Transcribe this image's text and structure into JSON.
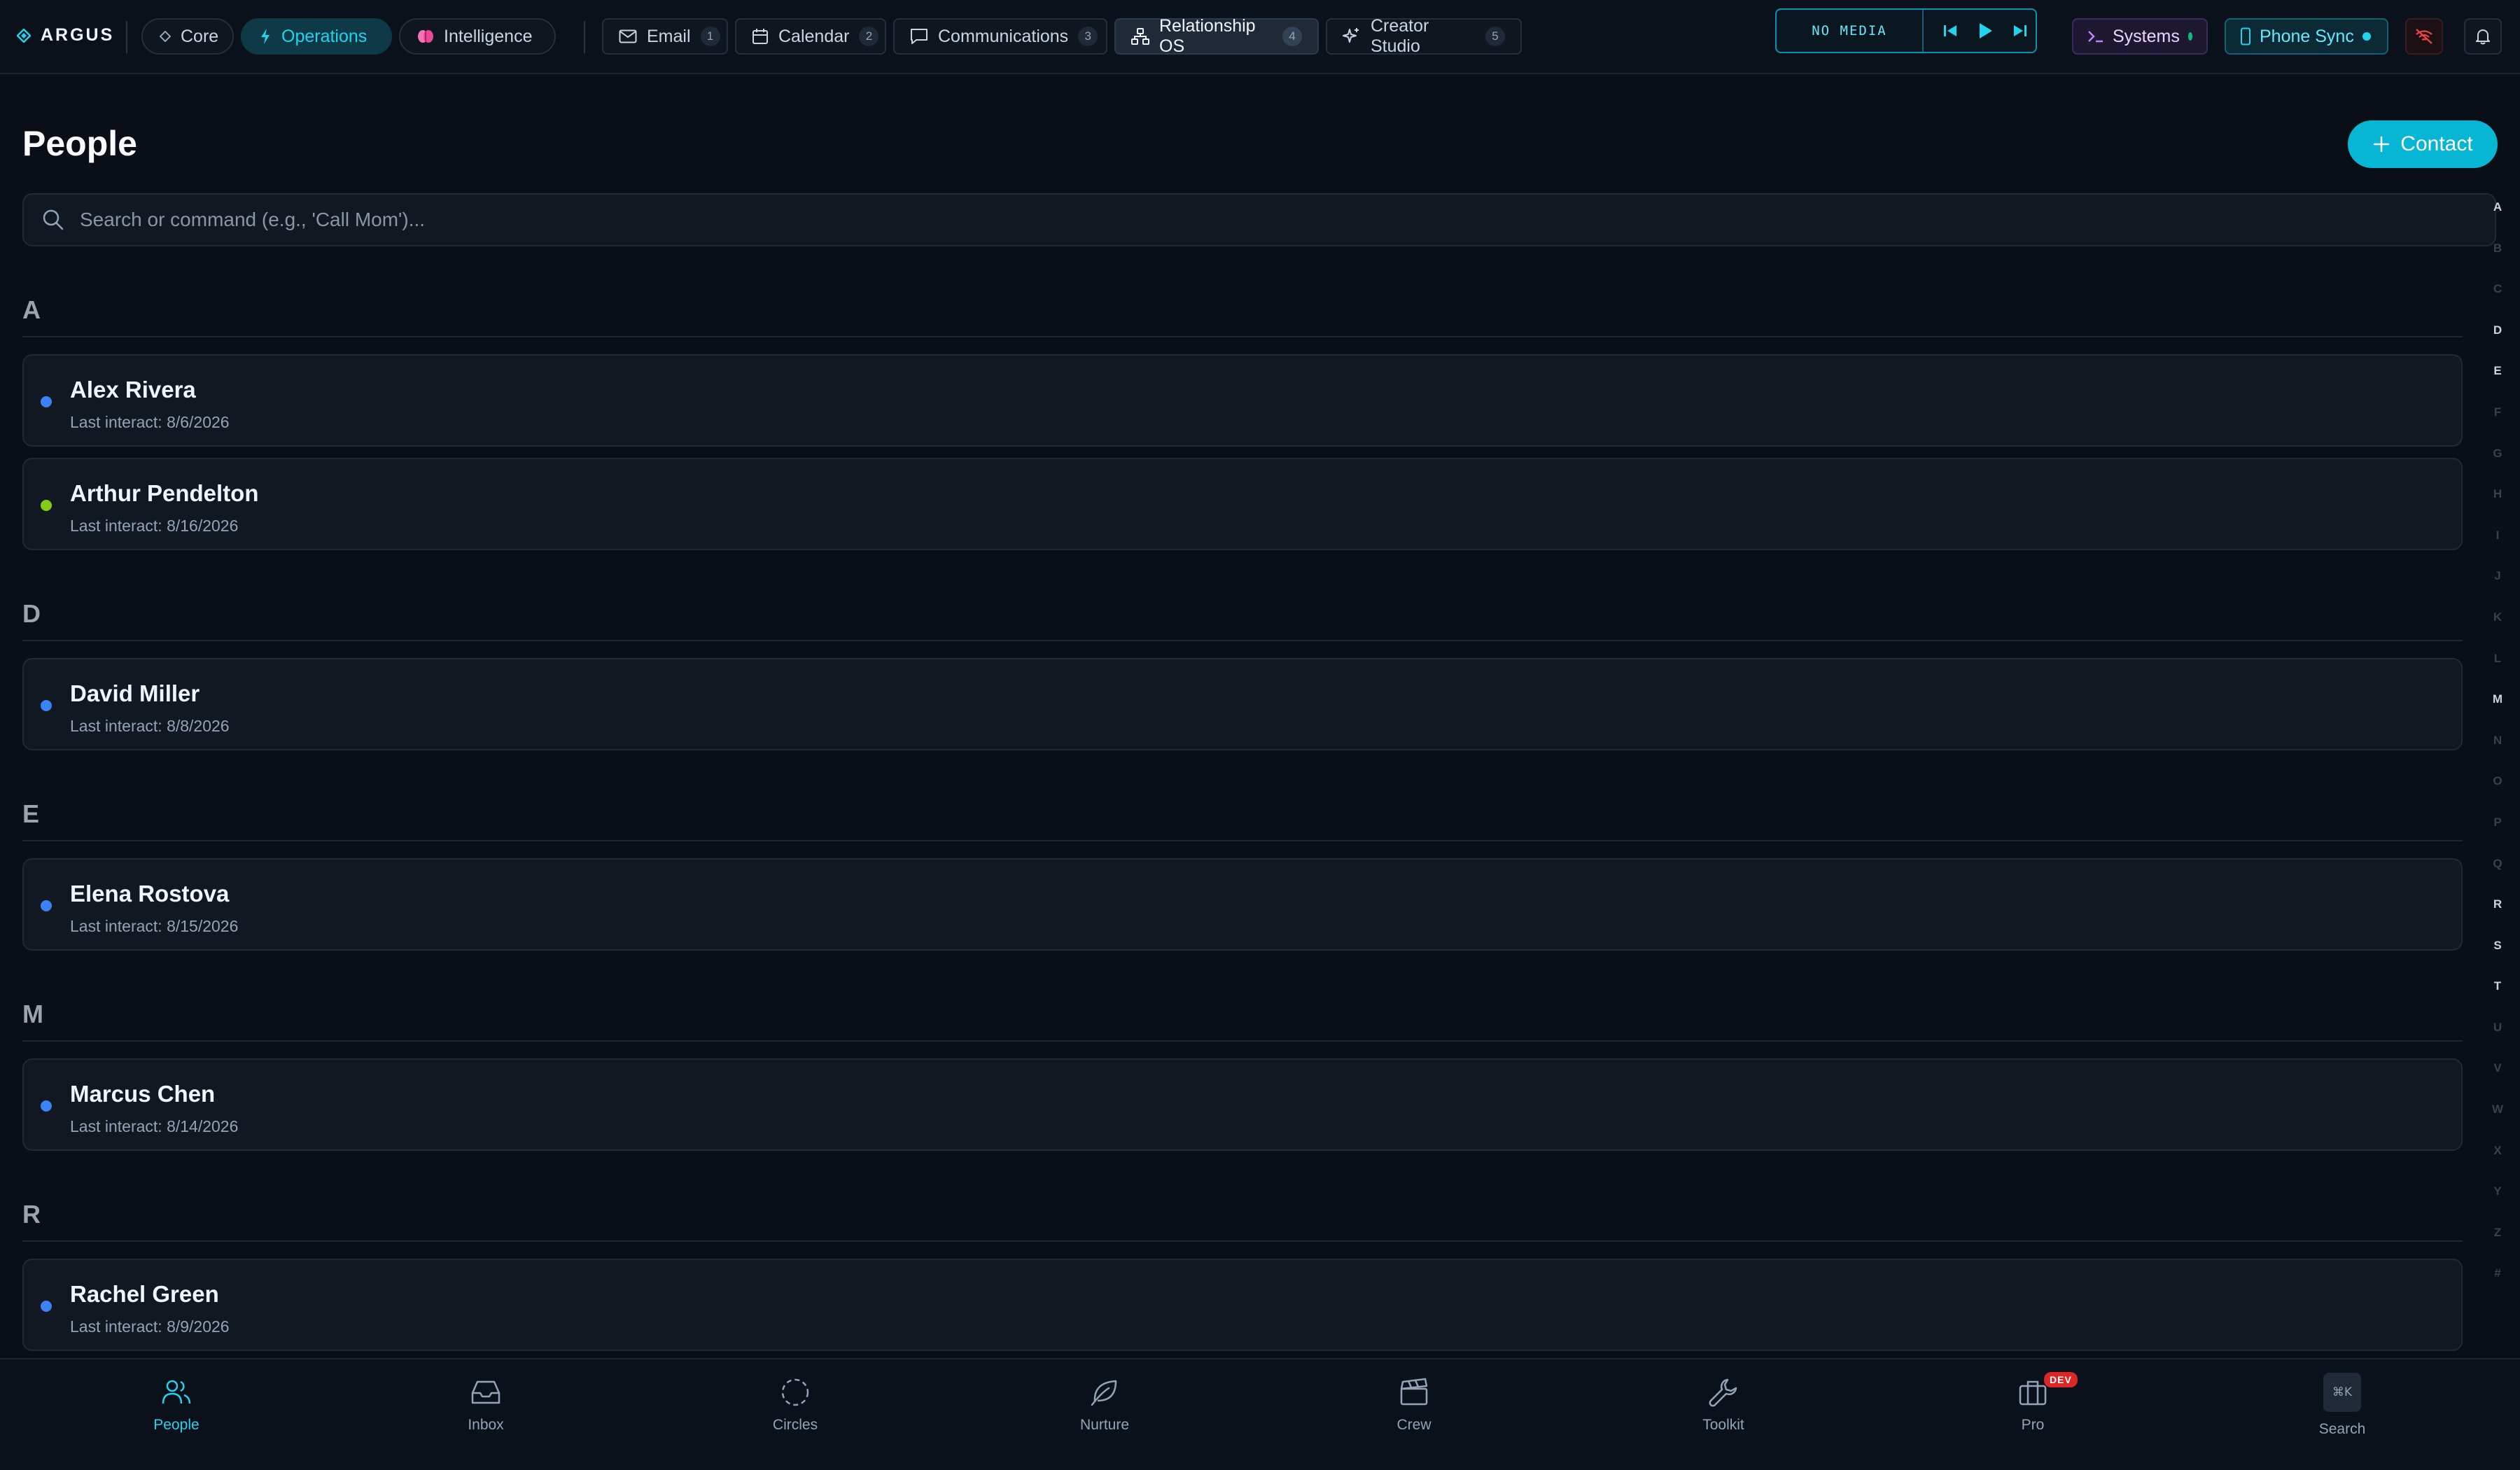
{
  "app": {
    "brand": "ARGUS"
  },
  "modes": [
    {
      "label": "Core",
      "icon": "diamond-icon"
    },
    {
      "label": "Operations",
      "icon": "bolt-icon",
      "active": true
    },
    {
      "label": "Intelligence",
      "icon": "brain-icon"
    }
  ],
  "tabs": [
    {
      "label": "Email",
      "badge": "1",
      "icon": "mail-icon"
    },
    {
      "label": "Calendar",
      "badge": "2",
      "icon": "calendar-icon"
    },
    {
      "label": "Communications",
      "badge": "3",
      "icon": "chat-icon"
    },
    {
      "label": "Relationship OS",
      "badge": "4",
      "icon": "network-icon",
      "active": true
    },
    {
      "label": "Creator Studio",
      "badge": "5",
      "icon": "sparkles-icon"
    }
  ],
  "media": {
    "label": "NO MEDIA"
  },
  "status": {
    "systems": "Systems",
    "phone_sync": "Phone Sync"
  },
  "colors": {
    "accent": "#22d3ee",
    "systems_ok": "#10b981",
    "phone_ok": "#22d3ee",
    "alert": "#ef4444"
  },
  "main": {
    "title": "People",
    "add_contact_label": "Contact",
    "search_placeholder": "Search or command (e.g., 'Call Mom')..."
  },
  "sections": [
    {
      "letter": "A",
      "contacts": [
        {
          "name": "Alex Rivera",
          "last": "Last interact: 8/6/2026",
          "dot": "#3b82f6"
        },
        {
          "name": "Arthur Pendelton",
          "last": "Last interact: 8/16/2026",
          "dot": "#84cc16"
        }
      ]
    },
    {
      "letter": "D",
      "contacts": [
        {
          "name": "David Miller",
          "last": "Last interact: 8/8/2026",
          "dot": "#3b82f6"
        }
      ]
    },
    {
      "letter": "E",
      "contacts": [
        {
          "name": "Elena Rostova",
          "last": "Last interact: 8/15/2026",
          "dot": "#3b82f6"
        }
      ]
    },
    {
      "letter": "M",
      "contacts": [
        {
          "name": "Marcus Chen",
          "last": "Last interact: 8/14/2026",
          "dot": "#3b82f6"
        }
      ]
    },
    {
      "letter": "R",
      "contacts": [
        {
          "name": "Rachel Green",
          "last": "Last interact: 8/9/2026",
          "dot": "#3b82f6"
        }
      ]
    }
  ],
  "alphabet": [
    "A",
    "B",
    "C",
    "D",
    "E",
    "F",
    "G",
    "H",
    "I",
    "J",
    "K",
    "L",
    "M",
    "N",
    "O",
    "P",
    "Q",
    "R",
    "S",
    "T",
    "U",
    "V",
    "W",
    "X",
    "Y",
    "Z",
    "#"
  ],
  "alphabet_active": [
    "A",
    "D",
    "E",
    "M",
    "R",
    "S",
    "T"
  ],
  "bottom_nav": [
    {
      "label": "People",
      "icon": "users-icon",
      "active": true
    },
    {
      "label": "Inbox",
      "icon": "inbox-icon"
    },
    {
      "label": "Circles",
      "icon": "dashed-circle-icon"
    },
    {
      "label": "Nurture",
      "icon": "leaf-icon"
    },
    {
      "label": "Crew",
      "icon": "clapperboard-icon"
    },
    {
      "label": "Toolkit",
      "icon": "wrench-icon"
    },
    {
      "label": "Pro",
      "icon": "briefcase-icon",
      "badge": "DEV"
    },
    {
      "label": "Search",
      "icon": "command-key-icon",
      "kbd": "⌘K"
    }
  ]
}
